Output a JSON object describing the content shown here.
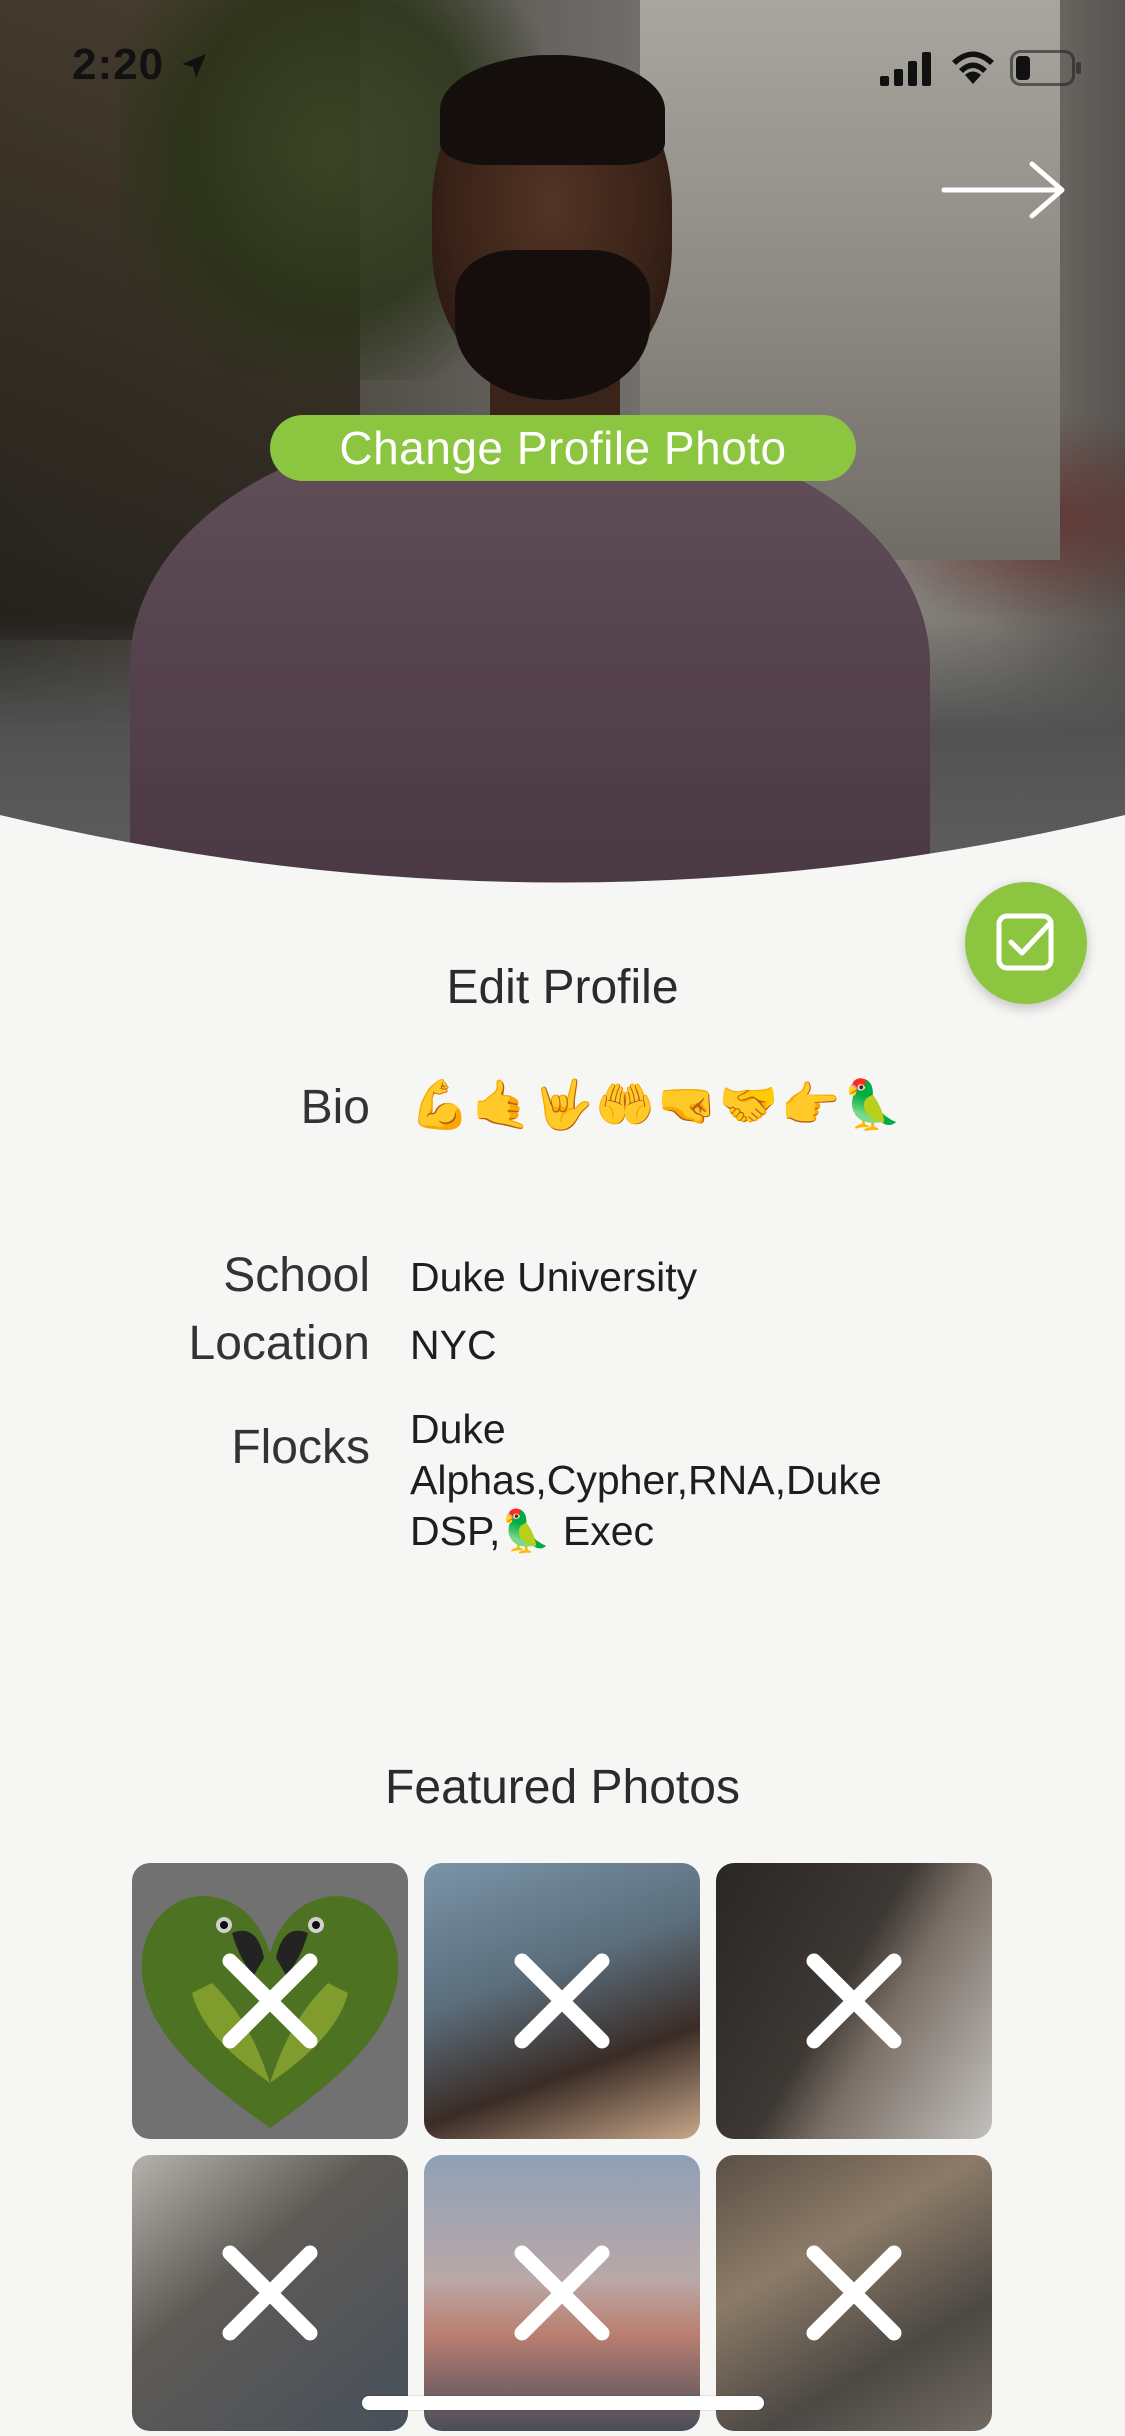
{
  "status_bar": {
    "time": "2:20"
  },
  "hero": {
    "change_photo_label": "Change Profile Photo"
  },
  "profile": {
    "title": "Edit Profile",
    "bio_label": "Bio",
    "bio_value": "💪🤙🤟🤲🤜🤝👉🦜",
    "school_label": "School",
    "school_value": "Duke University",
    "location_label": "Location",
    "location_value": "NYC",
    "flocks_label": "Flocks",
    "flocks_value": "Duke Alphas,Cypher,RNA,Duke DSP,🦜 Exec"
  },
  "featured": {
    "title": "Featured Photos"
  },
  "icons": {
    "next": "arrow-right-icon",
    "confirm": "checkbox-icon",
    "remove": "close-icon"
  },
  "colors": {
    "accent": "#8cc540",
    "background": "#f6f7f5"
  }
}
